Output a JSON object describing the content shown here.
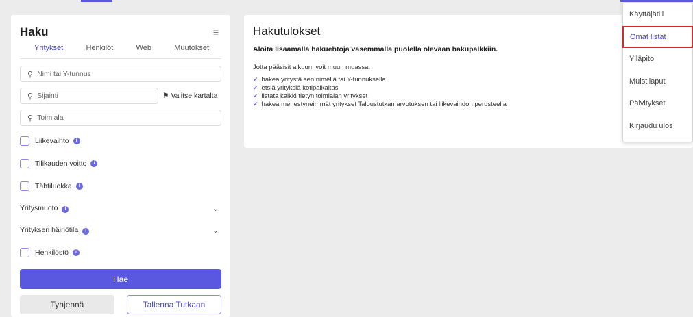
{
  "search": {
    "title": "Haku",
    "tabs": [
      "Yritykset",
      "Henkilöt",
      "Web",
      "Muutokset"
    ],
    "name_placeholder": "Nimi tai Y-tunnus",
    "location_placeholder": "Sijainti",
    "map_button": "Valitse kartalta",
    "industry_placeholder": "Toimiala",
    "filters": {
      "revenue": "Liikevaihto",
      "profit": "Tilikauden voitto",
      "star_class": "Tähtiluokka",
      "company_form": "Yritysmuoto",
      "disturbance": "Yrityksen häiriötila",
      "staff": "Henkilöstö"
    },
    "search_button": "Hae",
    "clear_button": "Tyhjennä",
    "save_button": "Tallenna Tutkaan"
  },
  "results": {
    "title": "Hakutulokset",
    "bold_hint": "Aloita lisäämällä hakuehtoja vasemmalla puolella olevaan hakupalkkiin.",
    "intro": "Jotta pääsisit alkuun, voit muun muassa:",
    "tips": [
      "hakea yritystä sen nimellä tai Y-tunnuksella",
      "etsiä yrityksiä kotipaikaltasi",
      "listata kaikki tietyn toimialan yritykset",
      "hakea menestyneimmät yritykset Taloustutkan arvotuksen tai liikevaihdon perusteella"
    ]
  },
  "user_menu": {
    "items": [
      "Käyttäjätili",
      "Omat listat",
      "Ylläpito",
      "Muistilaput",
      "Päivitykset",
      "Kirjaudu ulos"
    ],
    "highlighted": "Omat listat"
  },
  "colors": {
    "accent": "#5a58e0",
    "highlight_border": "#d9262a"
  }
}
